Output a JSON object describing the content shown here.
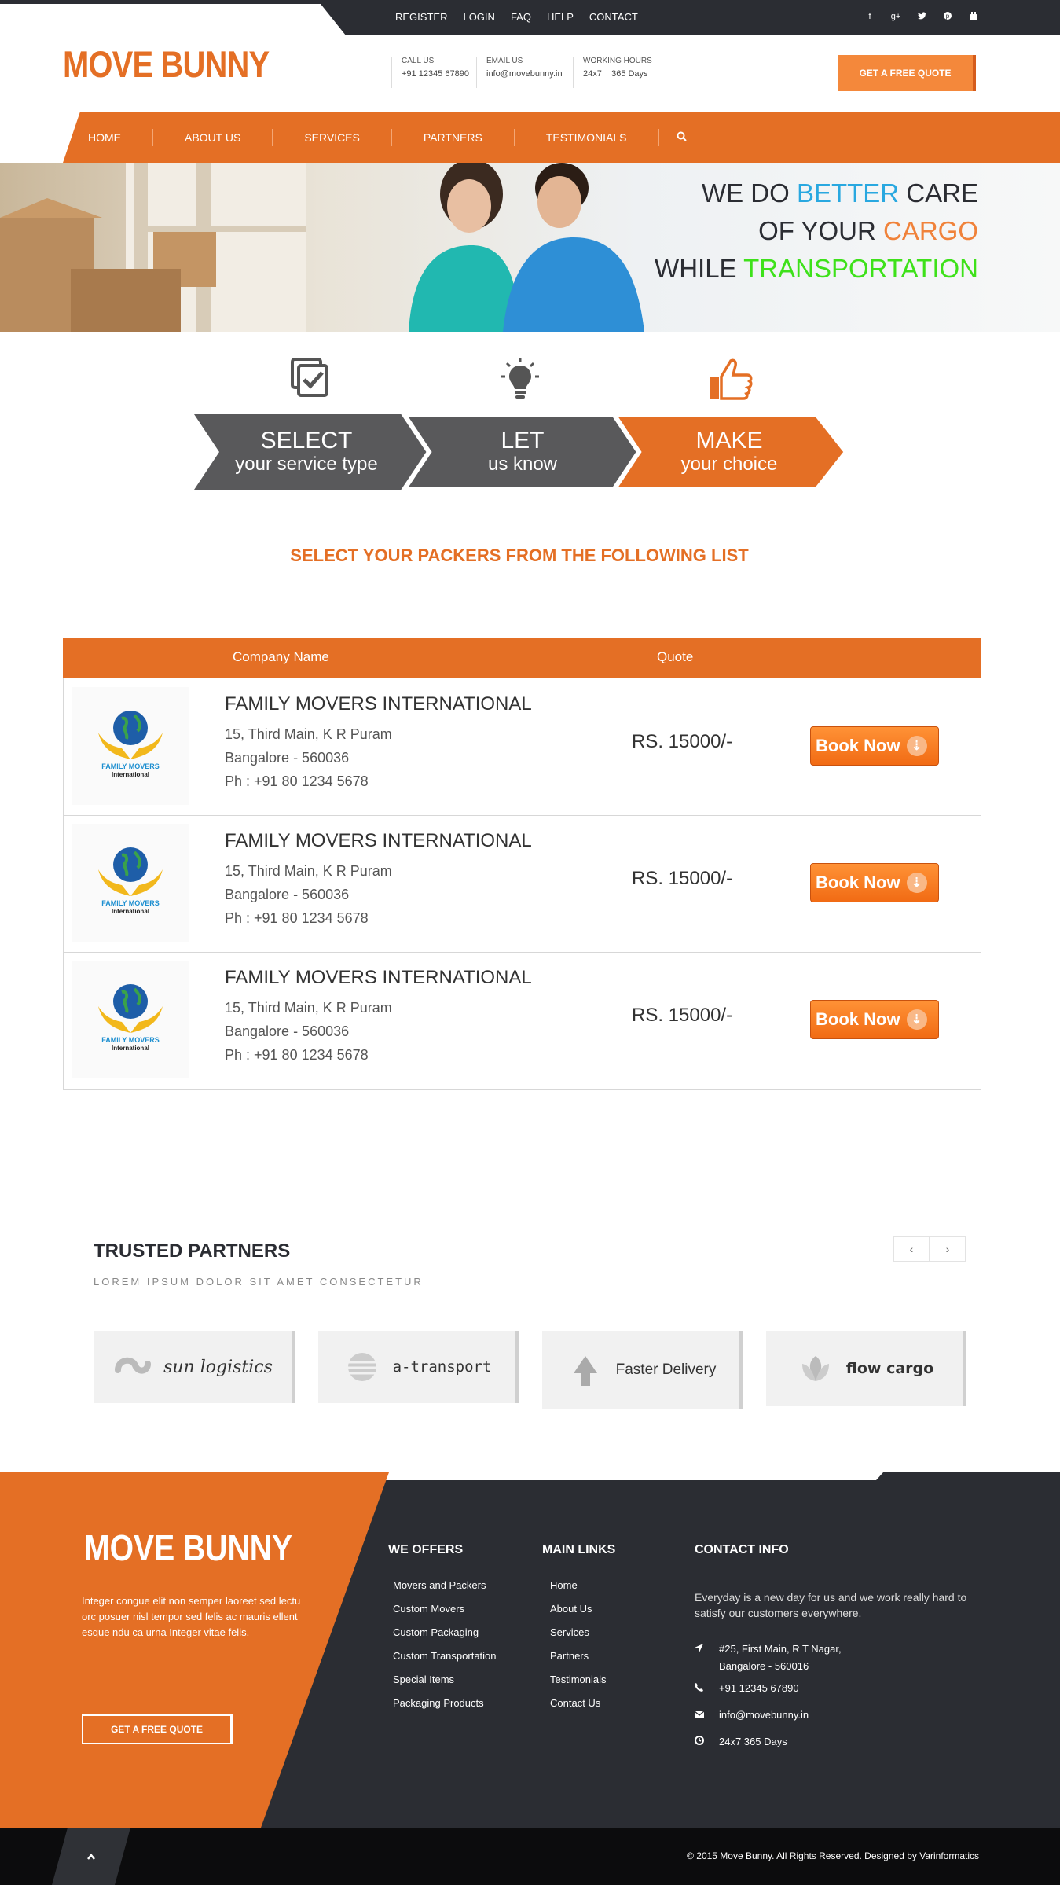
{
  "topbar": {
    "links": [
      "REGISTER",
      "LOGIN",
      "FAQ",
      "HELP",
      "CONTACT"
    ],
    "social_icons": [
      "facebook-icon",
      "google-plus-icon",
      "twitter-icon",
      "pinterest-icon",
      "youtube-icon"
    ]
  },
  "header": {
    "logo": "MOVE BUNNY",
    "call_label": "CALL US",
    "call_value": "+91 12345 67890",
    "email_label": "EMAIL US",
    "email_value": "info@movebunny.in",
    "hours_label": "WORKING HOURS",
    "hours_value": "24x7    365 Days",
    "quote_button": "GET A FREE QUOTE"
  },
  "nav": {
    "items": [
      "HOME",
      "ABOUT US",
      "SERVICES",
      "PARTNERS",
      "TESTIMONIALS"
    ]
  },
  "hero": {
    "line1_a": "WE DO ",
    "line1_b": "BETTER",
    "line1_c": " CARE",
    "line2_a": "OF YOUR ",
    "line2_b": "CARGO",
    "line3_a": "WHILE ",
    "line3_b": "TRANSPORTATION",
    "colors": {
      "better": "#29a8e0",
      "cargo": "#f0823a",
      "transportation": "#3ee11a"
    }
  },
  "steps": [
    {
      "title": "SELECT",
      "subtitle": "your service type",
      "icon": "checkbox-icon"
    },
    {
      "title": "LET",
      "subtitle": "us know",
      "icon": "lightbulb-icon"
    },
    {
      "title": "MAKE",
      "subtitle": "your choice",
      "icon": "thumbs-up-icon"
    }
  ],
  "section_title": "SELECT YOUR PACKERS FROM THE FOLLOWING LIST",
  "table": {
    "headers": {
      "company": "Company Name",
      "quote": "Quote"
    },
    "rows": [
      {
        "name": "FAMILY MOVERS INTERNATIONAL",
        "addr1": "15, Third Main, K R Puram",
        "addr2": "Bangalore - 560036",
        "phone": "Ph : +91 80 1234 5678",
        "quote": "RS. 15000/-",
        "button": "Book Now",
        "logo_text": "FAMILY MOVERS",
        "logo_sub": "International"
      },
      {
        "name": "FAMILY MOVERS INTERNATIONAL",
        "addr1": "15, Third Main, K R Puram",
        "addr2": "Bangalore - 560036",
        "phone": "Ph : +91 80 1234 5678",
        "quote": "RS. 15000/-",
        "button": "Book Now",
        "logo_text": "FAMILY MOVERS",
        "logo_sub": "International"
      },
      {
        "name": "FAMILY MOVERS INTERNATIONAL",
        "addr1": "15, Third Main, K R Puram",
        "addr2": "Bangalore - 560036",
        "phone": "Ph : +91 80 1234 5678",
        "quote": "RS. 15000/-",
        "button": "Book Now",
        "logo_text": "FAMILY MOVERS",
        "logo_sub": "International"
      }
    ]
  },
  "partners": {
    "title": "TRUSTED PARTNERS",
    "subtitle": "LOREM IPSUM DOLOR SIT AMET CONSECTETUR",
    "prev": "‹",
    "next": "›",
    "items": [
      "sun logistics",
      "a-transport",
      "Faster Delivery",
      "flow cargo"
    ]
  },
  "footer": {
    "logo": "MOVE BUNNY",
    "about": "Integer congue elit non semper laoreet sed lectu orc posuer nisl tempor sed felis ac mauris ellent esque ndu ca urna Integer vitae felis.",
    "quote_button": "GET A FREE QUOTE",
    "offers_title": "WE OFFERS",
    "offers": [
      "Movers and Packers",
      "Custom Movers",
      "Custom Packaging",
      "Custom Transportation",
      "Special Items",
      "Packaging Products"
    ],
    "links_title": "MAIN LINKS",
    "links": [
      "Home",
      "About Us",
      "Services",
      "Partners",
      "Testimonials",
      "Contact Us"
    ],
    "contact_title": "CONTACT INFO",
    "contact_intro": "Everyday is a new day for us and we work really hard to satisfy our customers everywhere.",
    "address1": "#25, First Main, R T Nagar,",
    "address2": "Bangalore - 560016",
    "phone": "+91 12345 67890",
    "email": "info@movebunny.in",
    "hours": "24x7 365 Days",
    "copyright": "© 2015 Move Bunny. All Rights Reserved. Designed by Varinformatics"
  }
}
